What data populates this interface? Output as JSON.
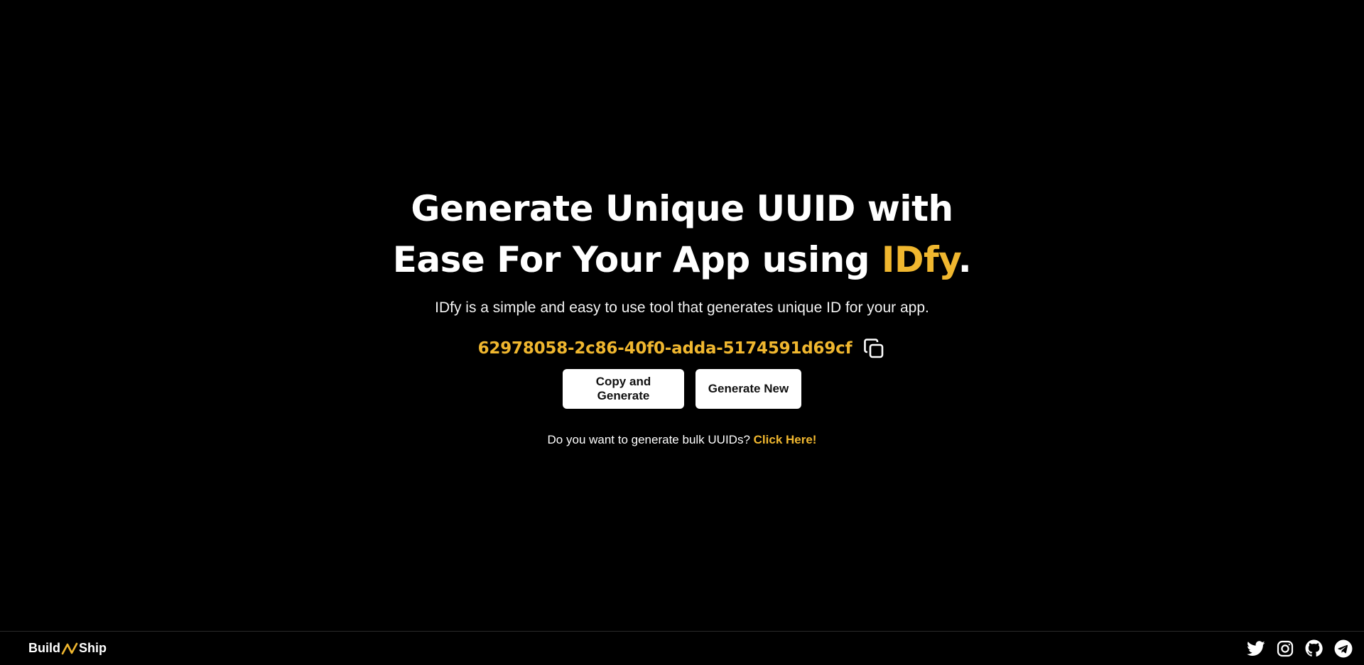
{
  "hero": {
    "headline_line1": "Generate Unique UUID with",
    "headline_line2_prefix": "Ease For Your App using ",
    "headline_accent": "IDfy",
    "headline_suffix": ".",
    "subtitle": "IDfy is a simple and easy to use tool that generates unique ID for your app."
  },
  "uuid": {
    "value": "62978058-2c86-40f0-adda-5174591d69cf",
    "copy_icon": "copy-icon"
  },
  "buttons": {
    "copy_generate_label": "Copy and Generate",
    "generate_new_label": "Generate New"
  },
  "bulk": {
    "prompt": "Do you want to generate bulk UUIDs?",
    "link_label": "Click Here!"
  },
  "footer": {
    "brand_left": "Build",
    "brand_right": "Ship",
    "socials": [
      "twitter-icon",
      "instagram-icon",
      "github-icon",
      "telegram-icon"
    ]
  },
  "colors": {
    "background": "#000000",
    "accent": "#f0b72f",
    "text": "#ffffff",
    "button_bg": "#ffffff"
  }
}
